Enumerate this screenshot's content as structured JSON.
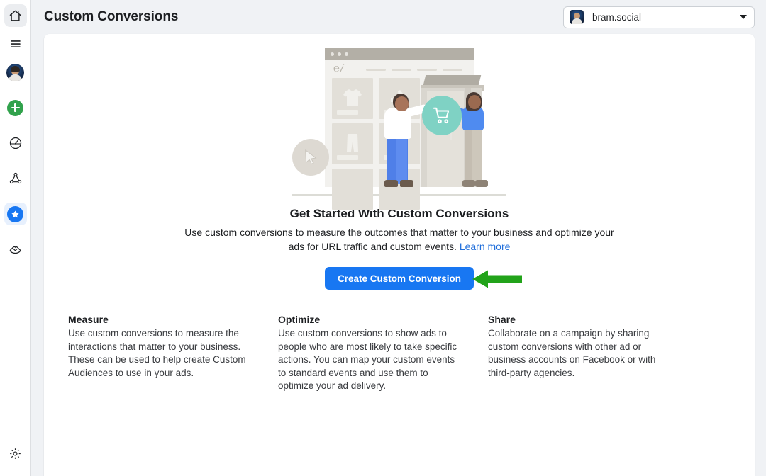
{
  "window": {
    "background_color": "#f0f2f5",
    "card_background": "#ffffff"
  },
  "sidebar": {
    "items": [
      {
        "name": "home",
        "icon": "home-icon",
        "active": true
      },
      {
        "name": "menu",
        "icon": "hamburger-menu-icon",
        "active": false
      },
      {
        "name": "profile",
        "icon": "avatar-icon",
        "active": false
      },
      {
        "name": "create",
        "icon": "plus-circle-icon",
        "active": false
      },
      {
        "name": "performance",
        "icon": "speedometer-icon",
        "active": false
      },
      {
        "name": "network",
        "icon": "network-nodes-icon",
        "active": false
      },
      {
        "name": "custom-conversions",
        "icon": "star-circle-icon",
        "active": true
      },
      {
        "name": "partnerships",
        "icon": "handshake-icon",
        "active": false
      }
    ],
    "bottom_item": {
      "name": "settings",
      "icon": "gear-icon"
    }
  },
  "header": {
    "title": "Custom Conversions",
    "account_selector": {
      "name": "bram.social",
      "avatar": "user-avatar",
      "chevron": "chevron-down-icon"
    }
  },
  "illustration": {
    "name": "storefront-shopping-illustration",
    "cart_badge_color": "#7fd2c4",
    "cursor_icon": "cursor-arrow-icon",
    "cart_icon": "shopping-cart-icon"
  },
  "empty_state": {
    "title": "Get Started With Custom Conversions",
    "description": "Use custom conversions to measure the outcomes that matter to your business and optimize your ads for URL traffic and custom events.",
    "learn_more_label": "Learn more",
    "cta_label": "Create Custom Conversion",
    "cta_color": "#1877f2",
    "annotation_arrow": {
      "direction": "left",
      "color": "#22a31a"
    }
  },
  "features": [
    {
      "title": "Measure",
      "body": "Use custom conversions to measure the interactions that matter to your business. These can be used to help create Custom Audiences to use in your ads."
    },
    {
      "title": "Optimize",
      "body": "Use custom conversions to show ads to people who are most likely to take specific actions. You can map your custom events to standard events and use them to optimize your ad delivery."
    },
    {
      "title": "Share",
      "body": "Collaborate on a campaign by sharing custom conversions with other ad or business accounts on Facebook or with third-party agencies."
    }
  ]
}
